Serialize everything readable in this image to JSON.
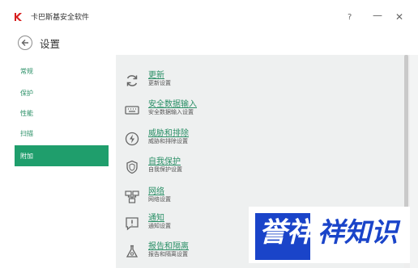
{
  "window": {
    "title": "卡巴斯基安全软件",
    "help_label": "?",
    "minimize_label": "—",
    "close_label": "✕"
  },
  "header": {
    "title": "设置"
  },
  "sidebar": {
    "items": [
      {
        "label": "常规"
      },
      {
        "label": "保护"
      },
      {
        "label": "性能"
      },
      {
        "label": "扫描"
      },
      {
        "label": "附加"
      }
    ],
    "active_index": 4
  },
  "settings": [
    {
      "title": "更新",
      "desc": "更新设置",
      "icon": "refresh-icon"
    },
    {
      "title": "安全数据输入",
      "desc": "安全数据输入设置",
      "icon": "keyboard-icon"
    },
    {
      "title": "威胁和排除",
      "desc": "威胁和排除设置",
      "icon": "lightning-icon"
    },
    {
      "title": "自我保护",
      "desc": "自我保护设置",
      "icon": "shield-icon"
    },
    {
      "title": "网络",
      "desc": "网络设置",
      "icon": "network-icon"
    },
    {
      "title": "通知",
      "desc": "通知设置",
      "icon": "notification-icon"
    },
    {
      "title": "报告和隔离",
      "desc": "报告和隔离设置",
      "icon": "flask-icon"
    }
  ],
  "watermark": {
    "text_highlight": "誉祥",
    "text_rest": "祥知识"
  },
  "colors": {
    "accent": "#1f9e6c",
    "link": "#2a8f66",
    "watermark": "#1a44c9"
  }
}
